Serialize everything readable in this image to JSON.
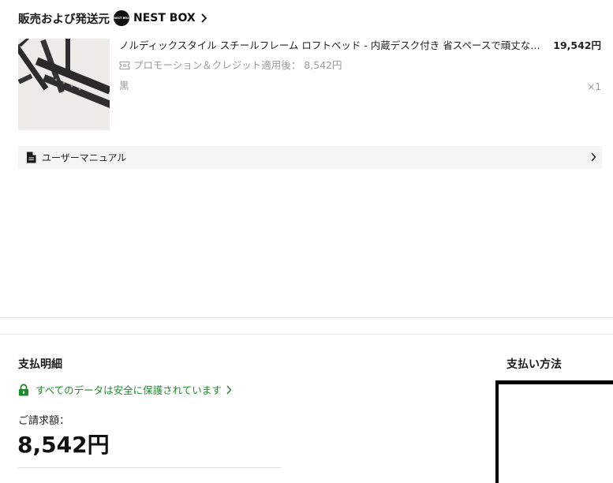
{
  "seller": {
    "label": "販売および発送元",
    "brand_logo_text": "NEST BOX",
    "brand_name": "NEST BOX"
  },
  "product": {
    "title": "ノルディックスタイル スチールフレーム ロフトベッド - 内蔵デスク付き 省スペースで頑丈なシングルベッド - 大人や子供、寮に最適",
    "price": "19,542円",
    "promo": "プロモーション＆クレジット適用後： 8,542円",
    "variant": "黒",
    "quantity": "×1"
  },
  "manual": {
    "label": "ユーザーマニュアル"
  },
  "payment": {
    "title": "支払明細",
    "secure_text": "すべてのデータは安全に保護されています",
    "billing_label": "ご請求額：",
    "billing_amount": "8,542円"
  },
  "method": {
    "title": "支払い方法"
  },
  "colors": {
    "secure_green": "#1f8a2c",
    "muted_gray": "#9a9a9a",
    "manual_bg": "#f5f5f5"
  }
}
